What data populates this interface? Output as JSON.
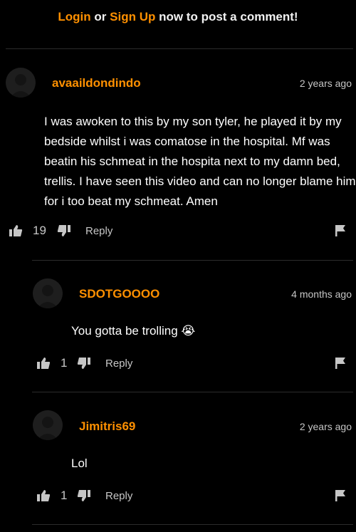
{
  "prompt": {
    "login_label": "Login",
    "or_label": "or",
    "signup_label": "Sign Up",
    "suffix": "now to post a comment!"
  },
  "comments": [
    {
      "username": "avaaildondindo",
      "timestamp": "2 years ago",
      "text": "I was awoken to this by my son tyler, he played it by my bedside whilst i was comatose in the hospital. Mf was beatin his schmeat in the hospita next to my damn bed, trellis. I have seen this video and can no longer blame him for i too beat my schmeat. Amen",
      "likes": "19",
      "reply_label": "Reply"
    },
    {
      "username": "SDOTGOOOO",
      "timestamp": "4 months ago",
      "text": "You gotta be trolling 😭",
      "likes": "1",
      "reply_label": "Reply"
    },
    {
      "username": "Jimitris69",
      "timestamp": "2 years ago",
      "text": "Lol",
      "likes": "1",
      "reply_label": "Reply"
    }
  ],
  "icons": {
    "like": "thumbs-up-icon",
    "dislike": "thumbs-down-icon",
    "flag": "flag-icon",
    "avatar": "default-avatar-icon"
  },
  "colors": {
    "background": "#000000",
    "accent": "#ff9000",
    "text": "#ffffff",
    "muted": "#c6c6c6",
    "divider": "#2c2c2c"
  }
}
